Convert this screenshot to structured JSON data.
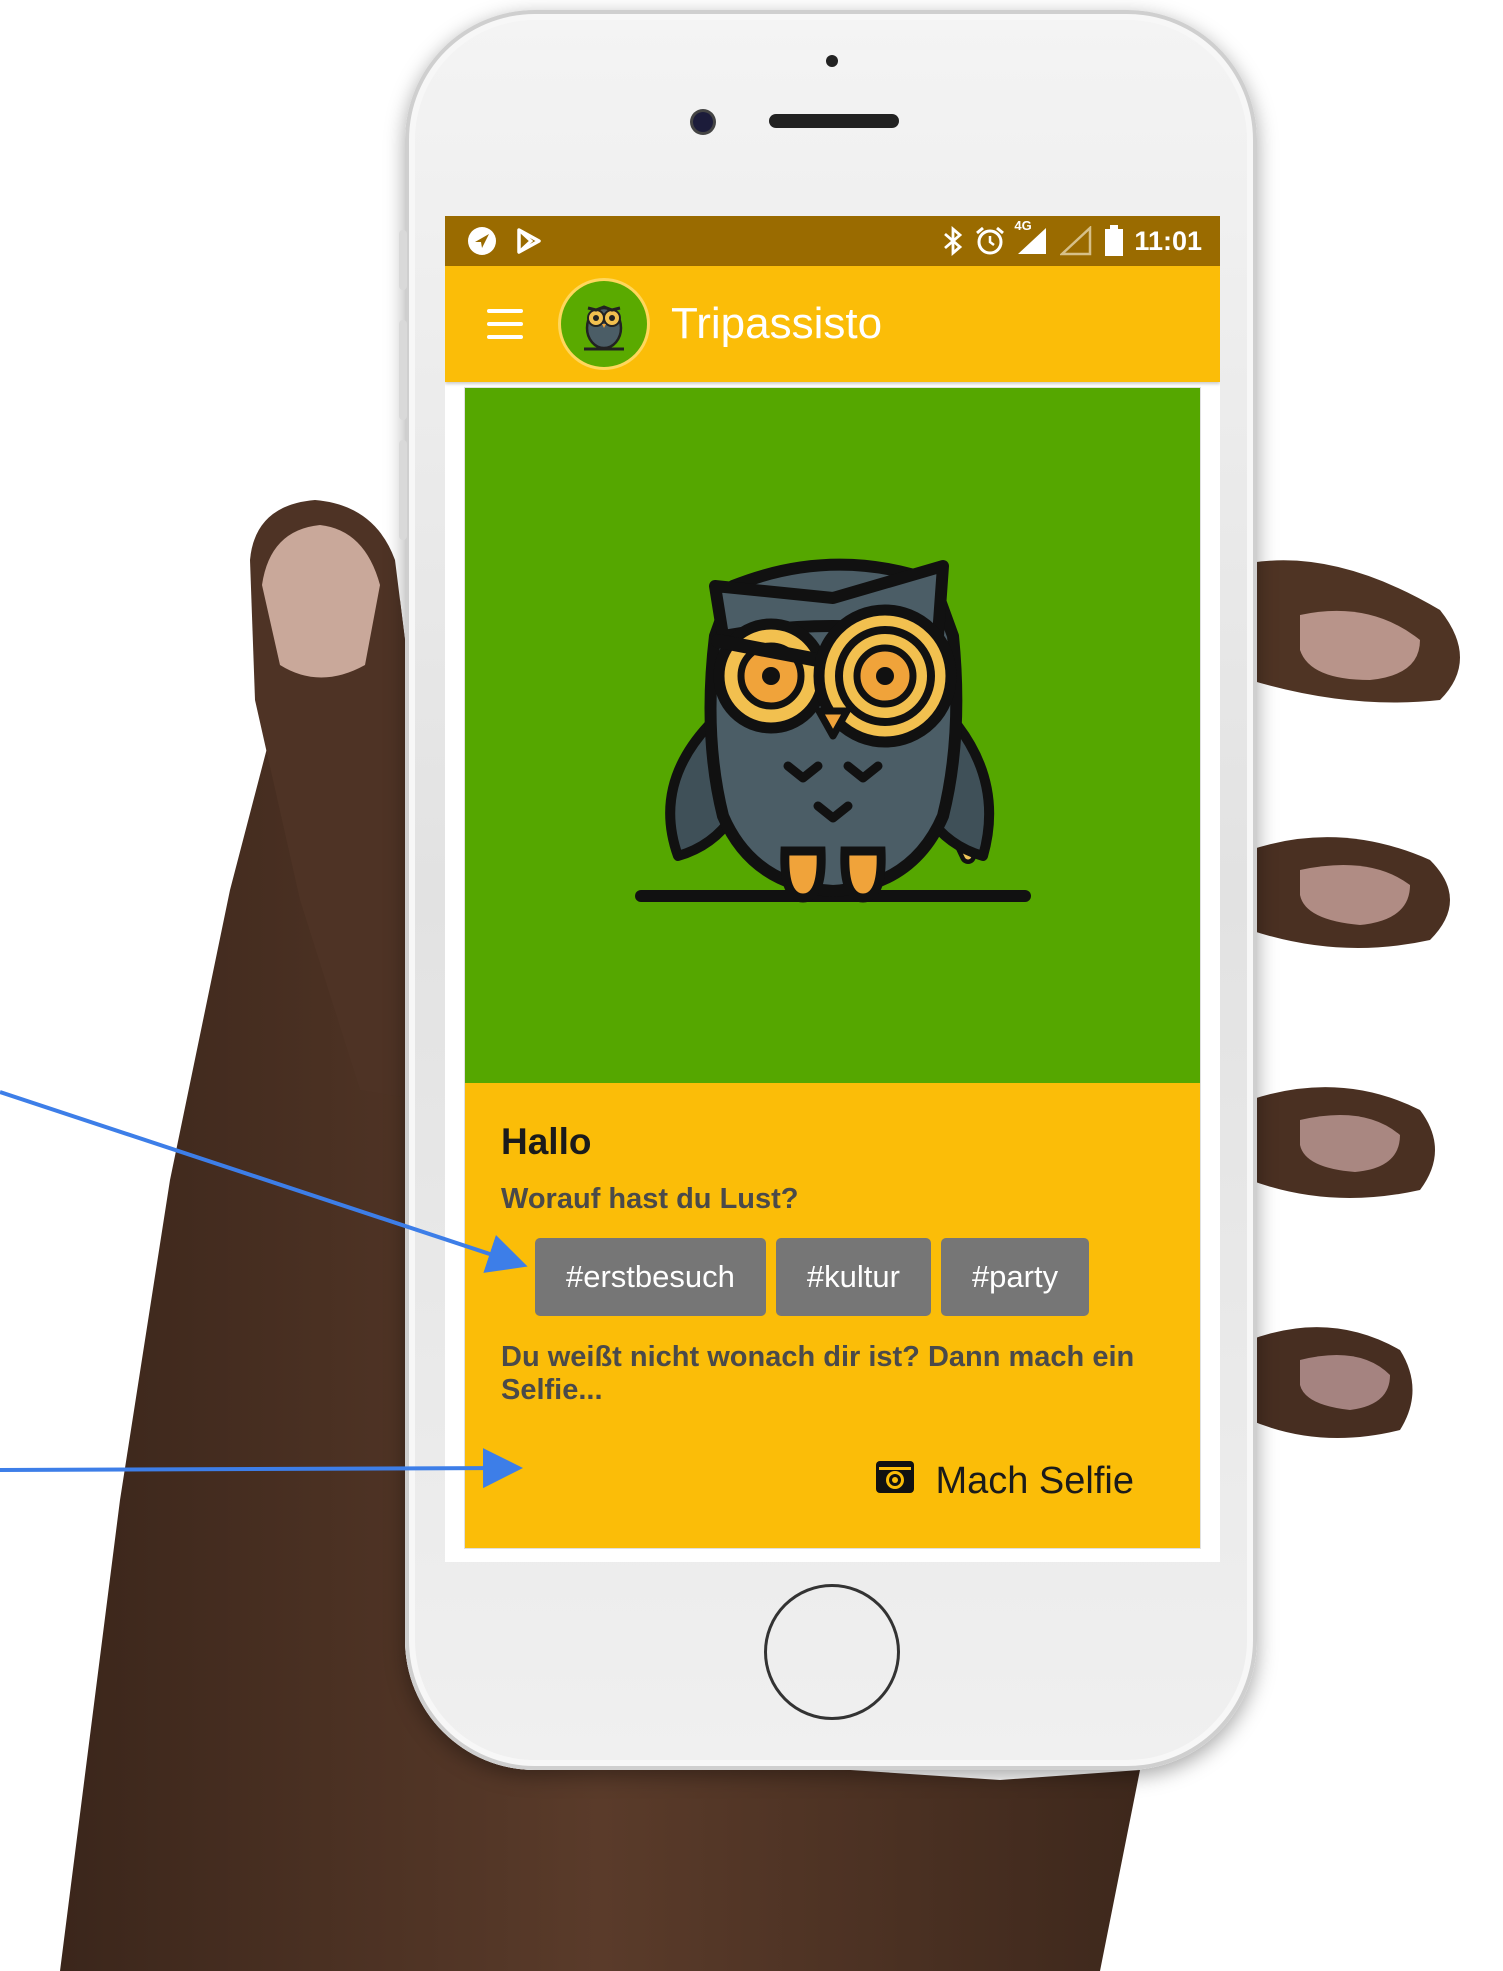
{
  "status_bar": {
    "time": "11:01",
    "network": "4G",
    "left_icons": [
      "navigation-icon",
      "play-store-icon"
    ],
    "right_icons": [
      "bluetooth-icon",
      "alarm-icon",
      "signal-icon",
      "battery-icon"
    ]
  },
  "app_bar": {
    "title": "Tripassisto",
    "menu_icon": "hamburger-menu-icon",
    "logo_icon": "owl-logo-icon"
  },
  "card": {
    "hero_icon": "owl-illustration",
    "greeting": "Hallo",
    "question": "Worauf hast du Lust?",
    "tags": [
      "#erstbesuch",
      "#kultur",
      "#party"
    ],
    "hint": "Du weißt nicht wonach dir ist? Dann mach ein Selfie...",
    "selfie_button": {
      "label": "Mach Selfie",
      "icon": "camera-icon"
    }
  },
  "colors": {
    "status_bar": "#9a6b00",
    "app_bar": "#fbbd08",
    "hero_background": "#55a700",
    "tag_background": "#767676",
    "annotation_arrow": "#3d7ee8"
  }
}
